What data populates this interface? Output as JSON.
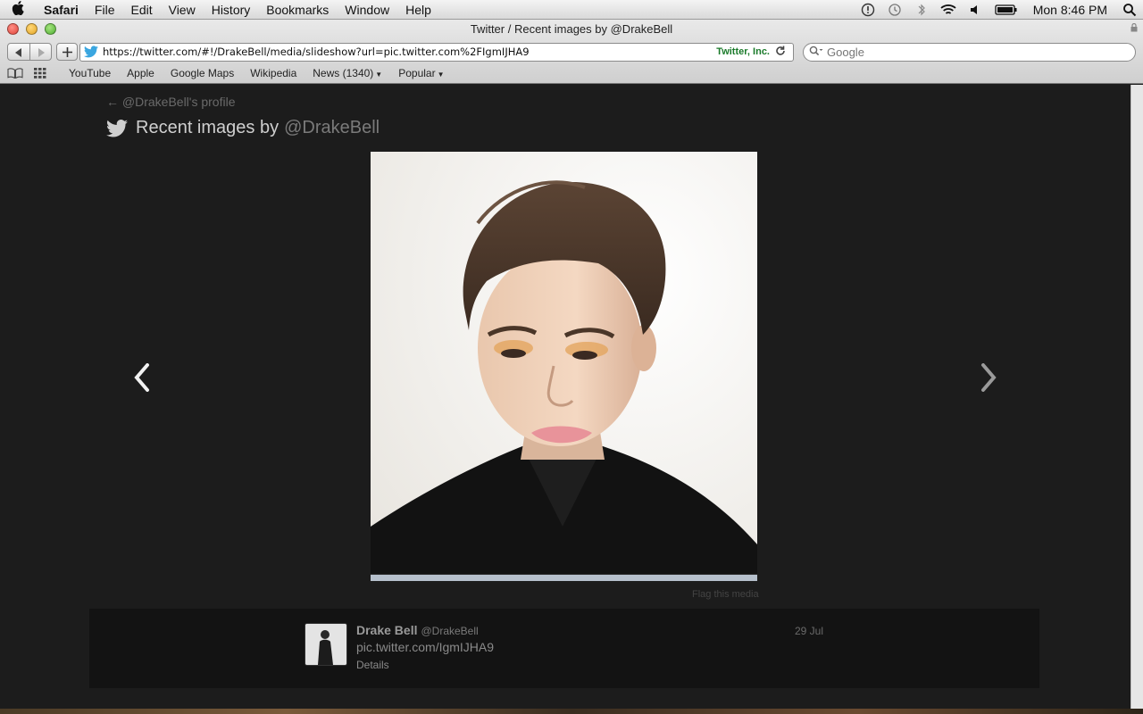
{
  "menubar": {
    "app_name": "Safari",
    "items": [
      "File",
      "Edit",
      "View",
      "History",
      "Bookmarks",
      "Window",
      "Help"
    ],
    "clock": "Mon 8:46 PM"
  },
  "window": {
    "title": "Twitter / Recent images by @DrakeBell"
  },
  "toolbar": {
    "url": "https://twitter.com/#!/DrakeBell/media/slideshow?url=pic.twitter.com%2FIgmIJHA9",
    "site_identity": "Twitter, Inc.",
    "search_placeholder": "Google"
  },
  "bookmarks": {
    "items": [
      "YouTube",
      "Apple",
      "Google Maps",
      "Wikipedia",
      "News (1340)",
      "Popular"
    ]
  },
  "page": {
    "back_link": "← @DrakeBell's profile",
    "heading_prefix": "Recent images by",
    "heading_handle": "@DrakeBell",
    "flag_link": "Flag this media",
    "tweet": {
      "name": "Drake Bell",
      "handle": "@DrakeBell",
      "text": "pic.twitter.com/IgmIJHA9",
      "details": "Details",
      "date": "29 Jul"
    }
  },
  "colors": {
    "page_background": "#1c1c1c",
    "twitter_blue": "#3aa6e0"
  }
}
